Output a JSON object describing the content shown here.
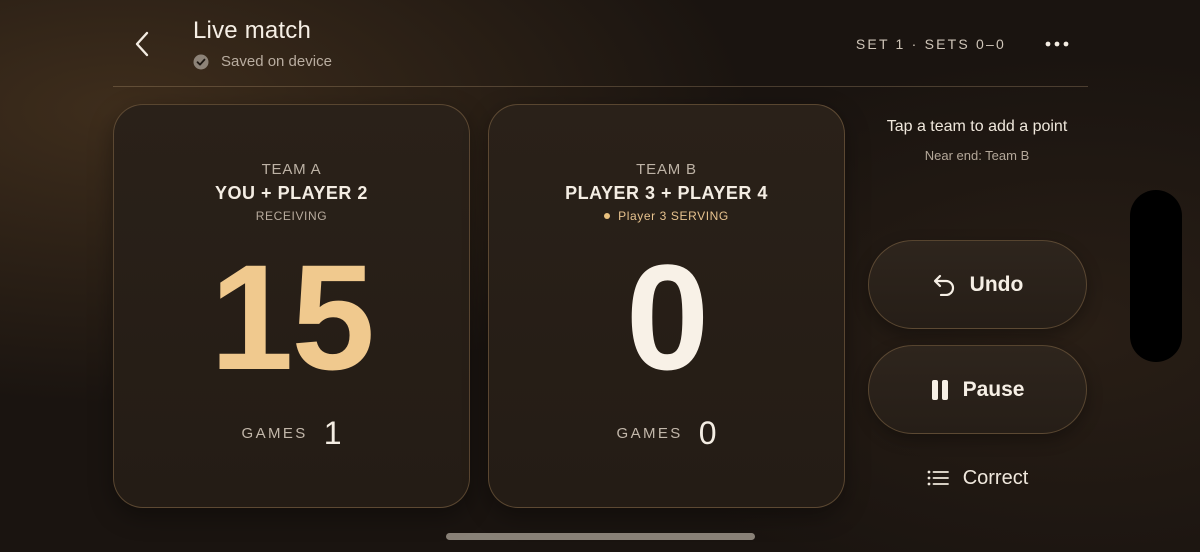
{
  "header": {
    "back_icon": "chevron-left-icon",
    "title": "Live match",
    "saved_status": "Saved on device",
    "saved_icon": "check-circle-icon",
    "set_info": "SET 1 · SETS 0–0",
    "more_icon": "more-horizontal-icon"
  },
  "teams": [
    {
      "label": "TEAM A",
      "players": "YOU + PLAYER 2",
      "status": "RECEIVING",
      "score": "15",
      "games_label": "GAMES",
      "games": "1"
    },
    {
      "label": "TEAM B",
      "players": "PLAYER 3 + PLAYER 4",
      "status": "Player 3 SERVING",
      "score": "0",
      "games_label": "GAMES",
      "games": "0"
    }
  ],
  "panel": {
    "hint": "Tap a team to add a point",
    "near_end": "Near end: Team B",
    "undo_label": "Undo",
    "undo_icon": "undo-icon",
    "pause_label": "Pause",
    "pause_icon": "pause-icon",
    "correct_label": "Correct",
    "correct_icon": "list-icon"
  },
  "colors": {
    "accent_gold": "#f0c98e",
    "background": "#1a1410",
    "card": "#2a2119",
    "serving_dot": "#e9c17e"
  }
}
